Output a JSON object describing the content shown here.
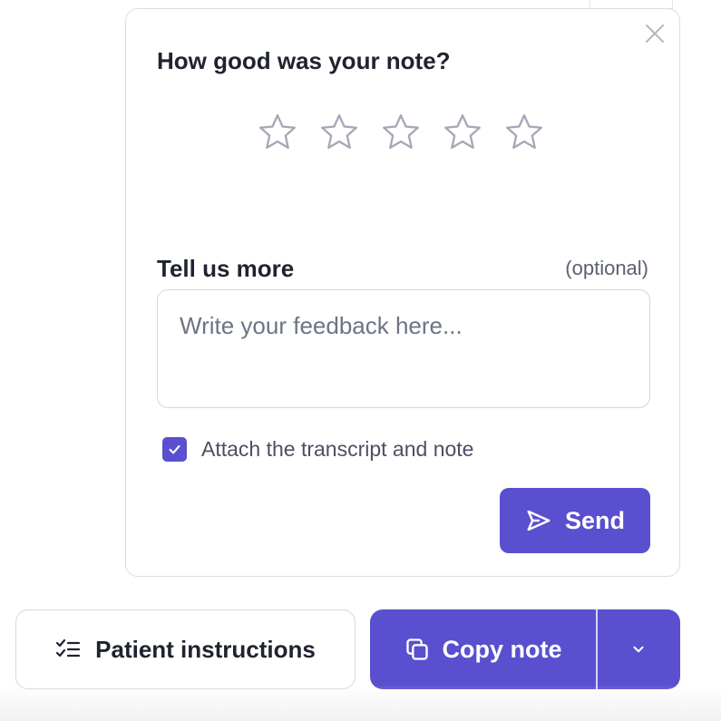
{
  "feedback_popup": {
    "title": "How good was your note?",
    "rating": {
      "value": 0,
      "max": 5
    },
    "more_label": "Tell us more",
    "optional_label": "(optional)",
    "feedback_placeholder": "Write your feedback here...",
    "feedback_value": "",
    "attach_label": "Attach the transcript and note",
    "attach_checked": true,
    "send_label": "Send"
  },
  "actions": {
    "patient_instructions_label": "Patient instructions",
    "copy_note_label": "Copy note"
  },
  "icons": {
    "close": "close-icon",
    "star": "star-outline-icon",
    "check": "check-icon",
    "send": "send-icon",
    "checklist": "checklist-icon",
    "copy": "copy-icon",
    "dropdown": "chevron-down-icon"
  },
  "colors": {
    "accent": "#5a4fcf",
    "star_outline": "#a4a8b6",
    "border": "#dcdce3"
  }
}
